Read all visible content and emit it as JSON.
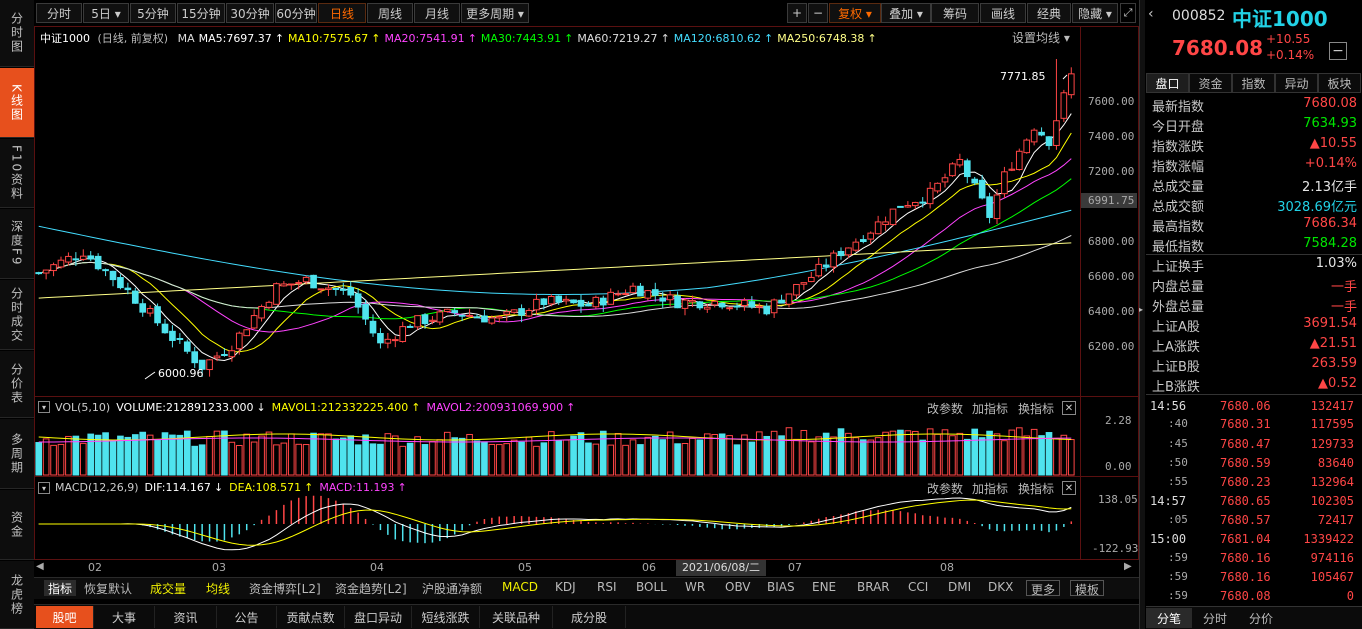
{
  "sidebar": [
    "分时图",
    "K线图",
    "F10资料",
    "深度F9",
    "分时成交",
    "分价表",
    "多周期",
    "资金",
    "龙虎榜"
  ],
  "toolbar": {
    "periods": [
      "分时",
      "5日",
      "5分钟",
      "15分钟",
      "30分钟",
      "60分钟",
      "日线",
      "周线",
      "月线",
      "更多周期"
    ],
    "right": [
      "+",
      "−",
      "复权",
      "叠加",
      "筹码",
      "画线",
      "经典",
      "隐藏"
    ],
    "selected": "日线"
  },
  "ma_bar": {
    "name": "中证1000",
    "desc": "(日线, 前复权)",
    "items": [
      {
        "label": "MA",
        "color": "#dddddd"
      },
      {
        "label": "MA5:7697.37",
        "color": "#ffffff"
      },
      {
        "label": "MA10:7575.67",
        "color": "#ffff00"
      },
      {
        "label": "MA20:7541.91",
        "color": "#ff44ff"
      },
      {
        "label": "MA30:7443.91",
        "color": "#00ff00"
      },
      {
        "label": "MA60:7219.27",
        "color": "#dddddd"
      },
      {
        "label": "MA120:6810.62",
        "color": "#44ddff"
      },
      {
        "label": "MA250:6748.38",
        "color": "#ffff88"
      }
    ],
    "settings": "设置均线"
  },
  "price_axis": [
    "7600.00",
    "7400.00",
    "7200.00",
    "6991.75",
    "6800.00",
    "6600.00",
    "6400.00",
    "6200.00"
  ],
  "annot": {
    "high": "7771.85",
    "low": "6000.96"
  },
  "vol_bar": {
    "name": "VOL(5,10)",
    "items": [
      {
        "label": "VOLUME:212891233.000",
        "color": "#ffffff"
      },
      {
        "label": "MAVOL1:212332225.400",
        "color": "#ffff00"
      },
      {
        "label": "MAVOL2:200931069.900",
        "color": "#ff44ff"
      }
    ],
    "axis": [
      "2.28",
      "0.00"
    ]
  },
  "macd_bar": {
    "name": "MACD(12,26,9)",
    "items": [
      {
        "label": "DIF:114.167",
        "color": "#ffffff"
      },
      {
        "label": "DEA:108.571",
        "color": "#ffff00"
      },
      {
        "label": "MACD:11.193",
        "color": "#ff44ff"
      }
    ],
    "axis": [
      "138.05",
      "-122.93"
    ]
  },
  "sub_tools": [
    "改参数",
    "加指标",
    "换指标"
  ],
  "date_axis": {
    "ticks": [
      "02",
      "03",
      "04",
      "05",
      "06",
      "07",
      "08"
    ],
    "cursor": "2021/06/08/二"
  },
  "bottom_tabs": [
    "指标",
    "恢复默认",
    "成交量",
    "均线",
    "资金博弈[L2]",
    "资金趋势[L2]",
    "沪股通净额",
    "MACD",
    "KDJ",
    "RSI",
    "BOLL",
    "WR",
    "OBV",
    "BIAS",
    "ENE",
    "BRAR",
    "CCI",
    "DMI",
    "DKX",
    "更多",
    "模板"
  ],
  "nav_tabs": [
    "股吧",
    "大事",
    "资讯",
    "公告",
    "贡献点数",
    "盘口异动",
    "短线涨跌",
    "关联品种",
    "成分股"
  ],
  "quote": {
    "code": "000852",
    "name": "中证1000",
    "price": "7680.08",
    "change": "+10.55",
    "pct": "+0.14%"
  },
  "right_tabs": [
    "盘口",
    "资金",
    "指数",
    "异动",
    "板块"
  ],
  "stats": [
    {
      "l": "最新指数",
      "v": "7680.08",
      "c": "red"
    },
    {
      "l": "今日开盘",
      "v": "7634.93",
      "c": "grn"
    },
    {
      "l": "指数涨跌",
      "v": "▲10.55",
      "c": "red"
    },
    {
      "l": "指数涨幅",
      "v": "+0.14%",
      "c": "red"
    },
    {
      "l": "总成交量",
      "v": "2.13亿手",
      "c": "wht"
    },
    {
      "l": "总成交额",
      "v": "3028.69亿元",
      "c": "cyan"
    },
    {
      "l": "最高指数",
      "v": "7686.34",
      "c": "red"
    },
    {
      "l": "最低指数",
      "v": "7584.28",
      "c": "grn"
    }
  ],
  "stats2": [
    {
      "l": "上证换手",
      "v": "1.03%",
      "c": "wht"
    },
    {
      "l": "内盘总量",
      "v": "一手",
      "c": "red"
    },
    {
      "l": "外盘总量",
      "v": "一手",
      "c": "red"
    },
    {
      "l": "上证A股",
      "v": "3691.54",
      "c": "red"
    },
    {
      "l": "上A涨跌",
      "v": "▲21.51",
      "c": "red"
    },
    {
      "l": "上证B股",
      "v": "263.59",
      "c": "red"
    },
    {
      "l": "上B涨跌",
      "v": "▲0.52",
      "c": "red"
    }
  ],
  "ticks": [
    {
      "t": "14:56",
      "p": "7680.06",
      "v": "132417",
      "big": true
    },
    {
      "t": ":40",
      "p": "7680.31",
      "v": "117595"
    },
    {
      "t": ":45",
      "p": "7680.47",
      "v": "129733"
    },
    {
      "t": ":50",
      "p": "7680.59",
      "v": "83640"
    },
    {
      "t": ":55",
      "p": "7680.23",
      "v": "132964"
    },
    {
      "t": "14:57",
      "p": "7680.65",
      "v": "102305",
      "big": true
    },
    {
      "t": ":05",
      "p": "7680.57",
      "v": "72417"
    },
    {
      "t": "15:00",
      "p": "7681.04",
      "v": "1339422",
      "big": true
    },
    {
      "t": ":59",
      "p": "7680.16",
      "v": "974116"
    },
    {
      "t": ":59",
      "p": "7680.16",
      "v": "105467"
    },
    {
      "t": ":59",
      "p": "7680.08",
      "v": "0"
    }
  ],
  "right_bottom_tabs": [
    "分笔",
    "分时",
    "分价"
  ],
  "chart_data": {
    "type": "candlestick",
    "candles_generated": true,
    "price_range": [
      6000,
      7800
    ]
  }
}
